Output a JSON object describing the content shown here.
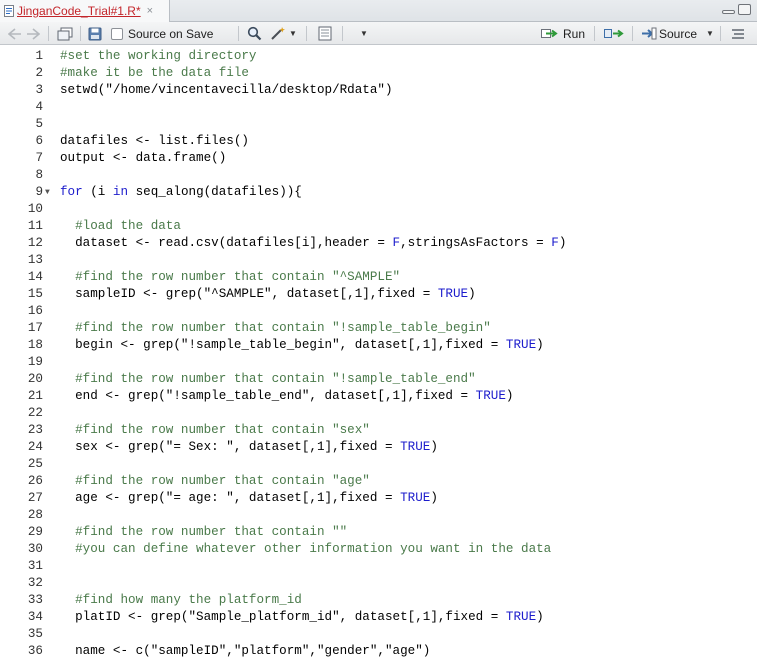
{
  "tab": {
    "title": "JinganCode_Trial#1.R*",
    "close": "×"
  },
  "toolbar": {
    "source_on_save": "Source on Save",
    "run": "Run",
    "source": "Source"
  },
  "colors": {
    "comment": "#4a7a4a",
    "keyword": "#1c1ccc",
    "tab_title": "#c3252a"
  },
  "lines": [
    {
      "n": "1",
      "t": "#set the working directory"
    },
    {
      "n": "2",
      "t": "#make it be the data file"
    },
    {
      "n": "3",
      "t": "setwd(\"/home/vincentavecilla/desktop/Rdata\")"
    },
    {
      "n": "4",
      "t": ""
    },
    {
      "n": "5",
      "t": ""
    },
    {
      "n": "6",
      "t": "datafiles <- list.files()"
    },
    {
      "n": "7",
      "t": "output <- data.frame()"
    },
    {
      "n": "8",
      "t": ""
    },
    {
      "n": "9",
      "t": "for (i in seq_along(datafiles)){",
      "fold": true
    },
    {
      "n": "10",
      "t": ""
    },
    {
      "n": "11",
      "t": "  #load the data"
    },
    {
      "n": "12",
      "t": "  dataset <- read.csv(datafiles[i],header = F,stringsAsFactors = F)"
    },
    {
      "n": "13",
      "t": ""
    },
    {
      "n": "14",
      "t": "  #find the row number that contain \"^SAMPLE\""
    },
    {
      "n": "15",
      "t": "  sampleID <- grep(\"^SAMPLE\", dataset[,1],fixed = TRUE)"
    },
    {
      "n": "16",
      "t": ""
    },
    {
      "n": "17",
      "t": "  #find the row number that contain \"!sample_table_begin\""
    },
    {
      "n": "18",
      "t": "  begin <- grep(\"!sample_table_begin\", dataset[,1],fixed = TRUE)"
    },
    {
      "n": "19",
      "t": ""
    },
    {
      "n": "20",
      "t": "  #find the row number that contain \"!sample_table_end\""
    },
    {
      "n": "21",
      "t": "  end <- grep(\"!sample_table_end\", dataset[,1],fixed = TRUE)"
    },
    {
      "n": "22",
      "t": ""
    },
    {
      "n": "23",
      "t": "  #find the row number that contain \"sex\""
    },
    {
      "n": "24",
      "t": "  sex <- grep(\"= Sex: \", dataset[,1],fixed = TRUE)"
    },
    {
      "n": "25",
      "t": ""
    },
    {
      "n": "26",
      "t": "  #find the row number that contain \"age\""
    },
    {
      "n": "27",
      "t": "  age <- grep(\"= age: \", dataset[,1],fixed = TRUE)"
    },
    {
      "n": "28",
      "t": ""
    },
    {
      "n": "29",
      "t": "  #find the row number that contain \"\""
    },
    {
      "n": "30",
      "t": "  #you can define whatever other information you want in the data"
    },
    {
      "n": "31",
      "t": ""
    },
    {
      "n": "32",
      "t": ""
    },
    {
      "n": "33",
      "t": "  #find how many the platform_id"
    },
    {
      "n": "34",
      "t": "  platID <- grep(\"Sample_platform_id\", dataset[,1],fixed = TRUE)"
    },
    {
      "n": "35",
      "t": ""
    },
    {
      "n": "36",
      "t": "  name <- c(\"sampleID\",\"platform\",\"gender\",\"age\")"
    }
  ]
}
